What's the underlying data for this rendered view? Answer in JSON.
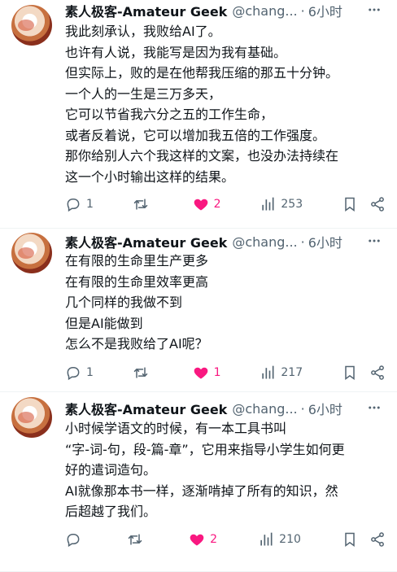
{
  "posts": [
    {
      "name": "素人极客-Amateur Geek",
      "handle": "@chang...",
      "dot": "·",
      "time": "6小时",
      "lines": [
        "我此刻承认，我败给AI了。",
        "也许有人说，我能写是因为我有基础。",
        "但实际上，败的是在他帮我压缩的那五十分钟。",
        "一个人的一生是三万多天，",
        "它可以节省我六分之五的工作生命，",
        "或者反着说，它可以增加我五倍的工作强度。",
        "那你给别人六个我这样的文案，也没办法持续在",
        "这一个小时输出这样的结果。"
      ],
      "replies": "1",
      "retweets": "",
      "likes": "2",
      "views": "253",
      "liked": true
    },
    {
      "name": "素人极客-Amateur Geek",
      "handle": "@chang...",
      "dot": "·",
      "time": "6小时",
      "lines": [
        "在有限的生命里生产更多",
        "在有限的生命里效率更高",
        "几个同样的我做不到",
        "但是AI能做到",
        "怎么不是我败给了AI呢？"
      ],
      "replies": "1",
      "retweets": "",
      "likes": "1",
      "views": "217",
      "liked": true
    },
    {
      "name": "素人极客-Amateur Geek",
      "handle": "@chang...",
      "dot": "·",
      "time": "6小时",
      "lines": [
        "小时候学语文的时候，有一本工具书叫",
        "“字-词-句，段-篇-章”，它用来指导小学生如何更",
        "好的遣词造句。",
        "AI就像那本书一样，逐渐啃掉了所有的知识，然",
        "后超越了我们。"
      ],
      "replies": "",
      "retweets": "",
      "likes": "2",
      "views": "210",
      "liked": true
    }
  ],
  "icons": {
    "reply": "reply-icon",
    "retweet": "retweet-icon",
    "like": "heart-icon",
    "views": "views-icon",
    "bookmark": "bookmark-icon",
    "share": "share-icon",
    "more": "more-icon"
  },
  "colors": {
    "text": "#0f1419",
    "secondary": "#536471",
    "like": "#f91880",
    "divider": "#eff3f4"
  }
}
